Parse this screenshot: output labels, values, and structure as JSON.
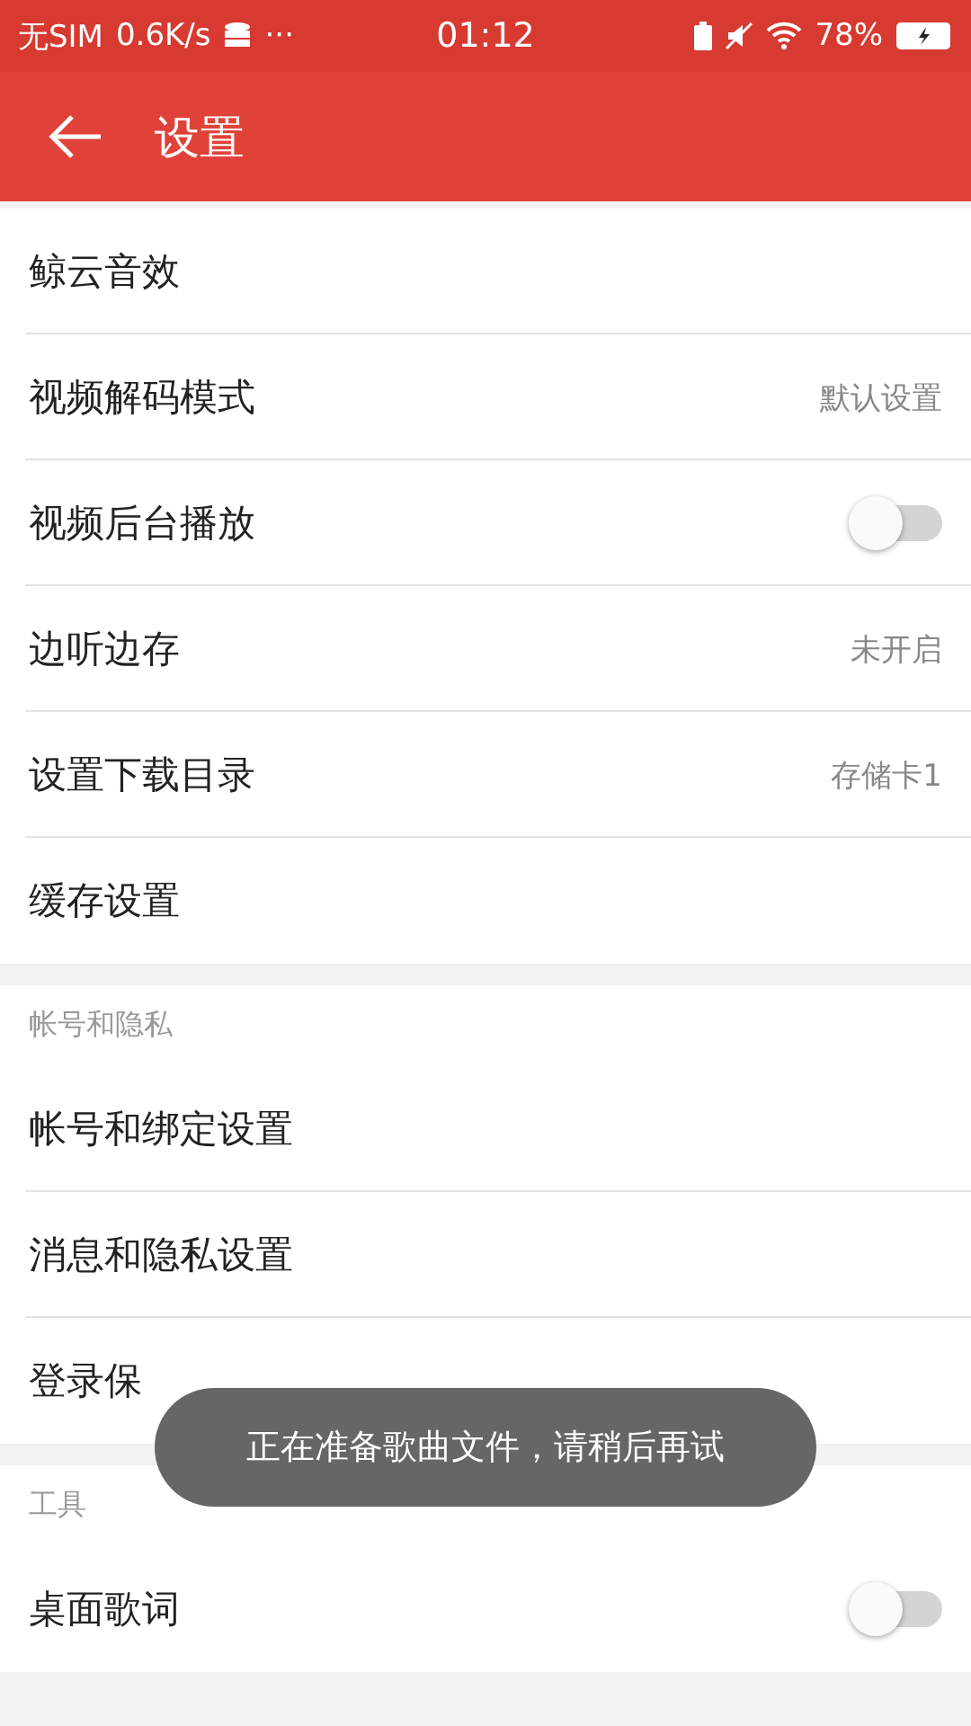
{
  "status_bar": {
    "carrier": "无SIM",
    "speed": "0.6K/s",
    "dots": "···",
    "time": "01:12",
    "battery": "78%"
  },
  "header": {
    "title": "设置"
  },
  "sections": [
    {
      "items": [
        {
          "kind": "link",
          "label": "鲸云音效"
        },
        {
          "kind": "value",
          "label": "视频解码模式",
          "value": "默认设置"
        },
        {
          "kind": "toggle",
          "label": "视频后台播放",
          "on": false
        },
        {
          "kind": "value",
          "label": "边听边存",
          "value": "未开启"
        },
        {
          "kind": "value",
          "label": "设置下载目录",
          "value": "存储卡1"
        },
        {
          "kind": "link",
          "label": "缓存设置"
        }
      ]
    },
    {
      "title": "帐号和隐私",
      "items": [
        {
          "kind": "link",
          "label": "帐号和绑定设置"
        },
        {
          "kind": "link",
          "label": "消息和隐私设置"
        },
        {
          "kind": "link",
          "label": "登录保"
        }
      ]
    },
    {
      "title": "工具",
      "items": [
        {
          "kind": "toggle",
          "label": "桌面歌词",
          "on": false
        }
      ]
    }
  ],
  "toast": "正在准备歌曲文件，请稍后再试"
}
